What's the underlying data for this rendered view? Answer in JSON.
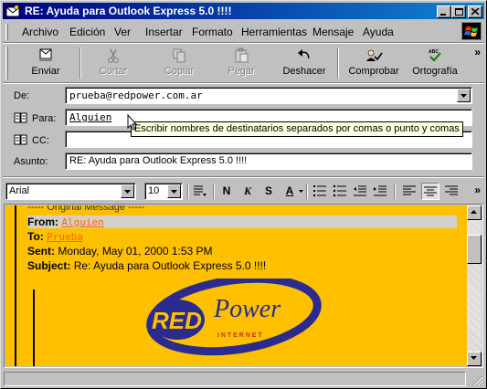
{
  "window": {
    "title": "RE: Ayuda para Outlook Express 5.0 !!!!"
  },
  "menu": {
    "items": [
      "Archivo",
      "Edición",
      "Ver",
      "Insertar",
      "Formato",
      "Herramientas",
      "Mensaje",
      "Ayuda"
    ]
  },
  "toolbar": {
    "enviar": "Enviar",
    "cortar": "Cortar",
    "copiar": "Copiar",
    "pegar": "Pegar",
    "deshacer": "Deshacer",
    "comprobar": "Comprobar",
    "ortografia": "Ortografía",
    "more": "»"
  },
  "header": {
    "de_label": "De:",
    "de_value": "prueba@redpower.com.ar",
    "para_label": "Para:",
    "para_value": "Alguien",
    "cc_label": "CC:",
    "cc_value": "",
    "asunto_label": "Asunto:",
    "asunto_value": "RE: Ayuda para Outlook Express 5.0 !!!!"
  },
  "tooltip": {
    "text": "Escribir nombres de destinatarios separados por comas o punto y comas"
  },
  "format": {
    "font": "Arial",
    "size": "10",
    "more": "»"
  },
  "message": {
    "original": "----- Original Message -----",
    "from_label": "From:",
    "from_value": "Alguien",
    "to_label": "To:",
    "to_value": "Prueba",
    "sent_label": "Sent:",
    "sent_value": "Monday, May 01, 2000 1:53 PM",
    "subject_label": "Subject:",
    "subject_value": "Re: Ayuda para Outlook Express 5.0 !!!!",
    "logo_red": "RED",
    "logo_power": "Power",
    "logo_internet": "I N T E R N E T"
  },
  "colors": {
    "title_start": "#000080",
    "title_end": "#1084d0",
    "body_bg": "#ffc000",
    "link": "#ff6600",
    "logo_blue": "#2b2b8f"
  },
  "icons": {
    "title": "outlook-express-icon",
    "enviar": "send-envelope-icon",
    "cortar": "scissors-icon",
    "copiar": "copy-icon",
    "pegar": "clipboard-icon",
    "deshacer": "undo-icon",
    "comprobar": "check-names-icon",
    "ortografia": "spelling-abc-icon",
    "address": "address-book-icon"
  }
}
